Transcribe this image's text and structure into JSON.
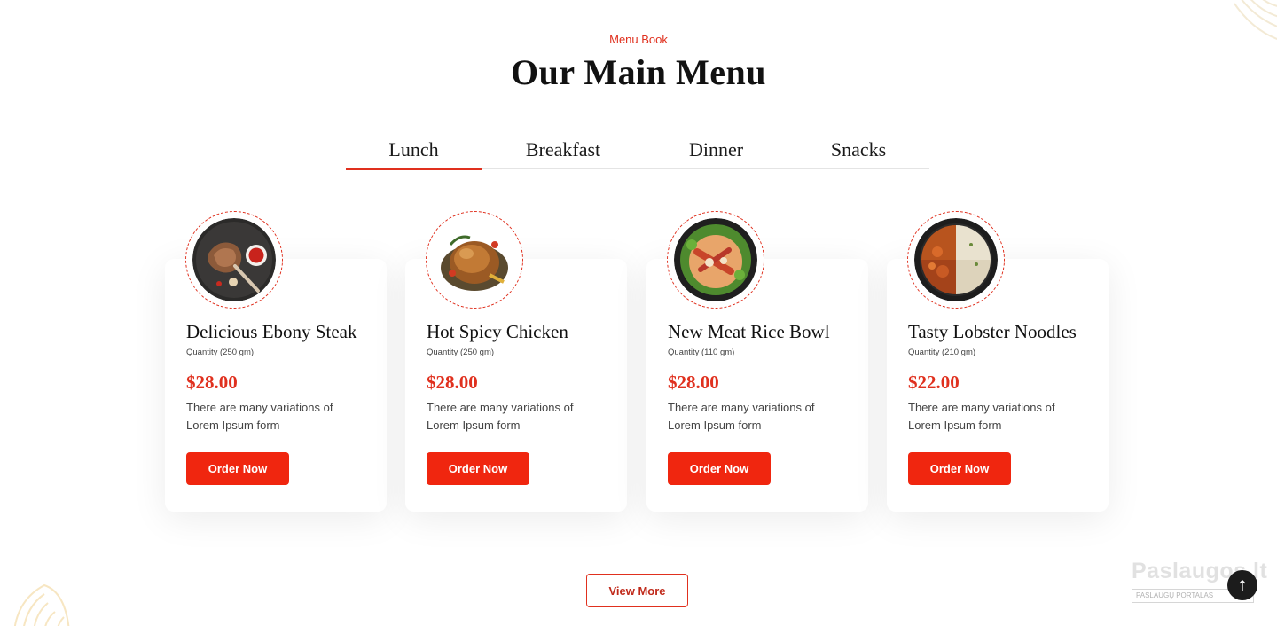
{
  "header": {
    "eyebrow": "Menu Book",
    "title": "Our Main Menu"
  },
  "tabs": [
    {
      "label": "Lunch",
      "active": true
    },
    {
      "label": "Breakfast",
      "active": false
    },
    {
      "label": "Dinner",
      "active": false
    },
    {
      "label": "Snacks",
      "active": false
    }
  ],
  "items": [
    {
      "name": "Delicious Ebony Steak",
      "quantity": "Quantity (250 gm)",
      "price": "$28.00",
      "description": "There are many variations of Lorem Ipsum form",
      "button": "Order Now",
      "image": "steak-plate"
    },
    {
      "name": "Hot Spicy Chicken",
      "quantity": "Quantity (250 gm)",
      "price": "$28.00",
      "description": "There are many variations of Lorem Ipsum form",
      "button": "Order Now",
      "image": "roast-chicken"
    },
    {
      "name": "New Meat Rice Bowl",
      "quantity": "Quantity (110 gm)",
      "price": "$28.00",
      "description": "There are many variations of Lorem Ipsum form",
      "button": "Order Now",
      "image": "meat-rice-bowl"
    },
    {
      "name": "Tasty Lobster Noodles",
      "quantity": "Quantity (210 gm)",
      "price": "$22.00",
      "description": "There are many variations of Lorem Ipsum form",
      "button": "Order Now",
      "image": "lobster-noodles"
    }
  ],
  "footer": {
    "view_more": "View More"
  },
  "watermark": {
    "text": "Paslaugos.lt",
    "sub": "PASLAUGŲ PORTALAS"
  },
  "scroll_top_icon": "arrow-up-icon",
  "colors": {
    "accent": "#e0301e",
    "button": "#f0260f",
    "text": "#111111"
  }
}
